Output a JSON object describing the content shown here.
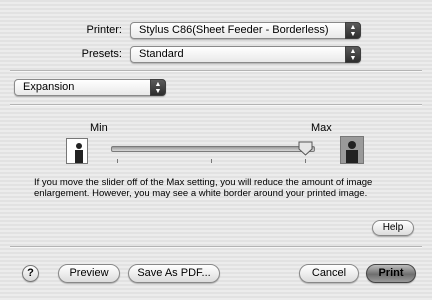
{
  "printer": {
    "label": "Printer:",
    "value": "Stylus C86(Sheet Feeder - Borderless)"
  },
  "presets": {
    "label": "Presets:",
    "value": "Standard"
  },
  "panel": {
    "value": "Expansion"
  },
  "expansion": {
    "min_label": "Min",
    "max_label": "Max",
    "level": 1.0,
    "description": "If you move the slider off of the Max setting, you will reduce the amount of image enlargement. However, you may see a white border around your printed image."
  },
  "buttons": {
    "help": "Help",
    "help_icon": "?",
    "preview": "Preview",
    "save_pdf": "Save As PDF...",
    "cancel": "Cancel",
    "print": "Print"
  }
}
